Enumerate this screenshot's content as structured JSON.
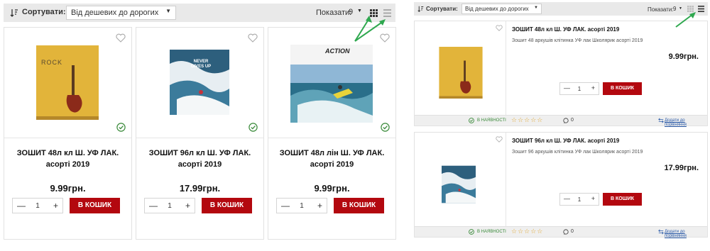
{
  "toolbar": {
    "sort_label": "Сортувати:",
    "sort_value": "Від дешевих до дорогих",
    "show_label": "Показати:",
    "show_value": "9"
  },
  "products": [
    {
      "title": "ЗОШИТ 48л кл Ш. УФ ЛАК. асорті 2019",
      "price": "9.99грн.",
      "qty": "1",
      "cart_label": "В КОШИК",
      "cover_text": "ROCK"
    },
    {
      "title": "ЗОШИТ 96л кл Ш. УФ ЛАК. асорті 2019",
      "price": "17.99грн.",
      "qty": "1",
      "cart_label": "В КОШИК",
      "cover_text": "NEVER GIVES UP"
    },
    {
      "title": "ЗОШИТ 48л лін Ш. УФ ЛАК. асорті 2019",
      "price": "9.99грн.",
      "qty": "1",
      "cart_label": "В КОШИК",
      "cover_text": "ACTION"
    }
  ],
  "list_items": [
    {
      "title": "ЗОШИТ 48л кл Ш. УФ ЛАК. асорті 2019",
      "desc": "Зошит 48 аркушів клітинка  УФ лак Школярик асорті 2019",
      "price": "9.99грн.",
      "qty": "1",
      "cart_label": "В КОШИК",
      "availability": "В НАЯВНОСТІ",
      "stars": "☆☆☆☆☆",
      "comments": "0",
      "compare": "Додати до порівняння"
    },
    {
      "title": "ЗОШИТ 96л кл Ш. УФ ЛАК. асорті 2019",
      "desc": "Зошит 96 аркушів клітинка  УФ лак Школярик асорті 2019",
      "price": "17.99грн.",
      "qty": "1",
      "cart_label": "В КОШИК",
      "availability": "В НАЯВНОСТІ",
      "stars": "☆☆☆☆☆",
      "comments": "0",
      "compare": "Додати до порівняння"
    }
  ],
  "colors": {
    "accent": "#b3080f",
    "arrow": "#2fa84f",
    "available": "#3a8a3a",
    "toolbar_bg": "#e9e9e9"
  }
}
